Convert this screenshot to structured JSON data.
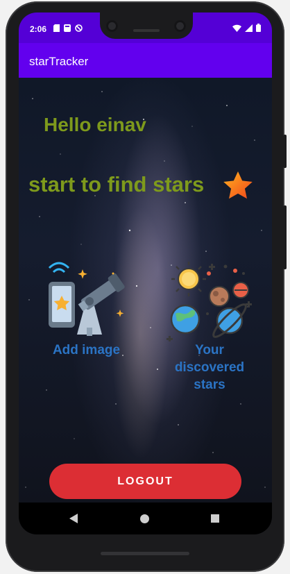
{
  "status_bar": {
    "time": "2:06",
    "left_icons": [
      "sd-card-icon",
      "notification-icon",
      "do-not-disturb-icon"
    ],
    "right_icons": [
      "wifi-icon",
      "signal-icon",
      "battery-icon"
    ]
  },
  "app_bar": {
    "title": "starTracker"
  },
  "main": {
    "greeting": "Hello einav",
    "headline": "start to find stars",
    "headline_icon": "star-icon",
    "tiles": [
      {
        "label": "Add image",
        "icon": "telescope-phone-icon"
      },
      {
        "label_lines": [
          "Your",
          "discovered",
          "stars"
        ],
        "icon": "planets-icon"
      }
    ],
    "logout_label": "LOGOUT"
  },
  "nav_bar": {
    "items": [
      "back-icon",
      "home-icon",
      "recents-icon"
    ]
  },
  "colors": {
    "status_bar": "#5400d6",
    "app_bar": "#6200ee",
    "text_green": "#7e9a1c",
    "label_blue": "#2b74c5",
    "logout_red": "#dc2e34"
  }
}
